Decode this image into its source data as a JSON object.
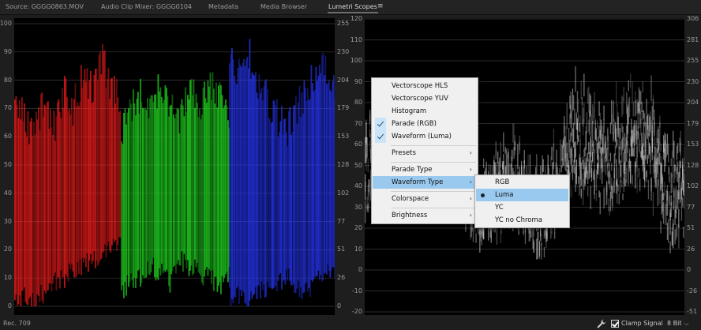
{
  "tabs": [
    {
      "label": "Source: GGGG0863.MOV",
      "active": false
    },
    {
      "label": "Audio Clip Mixer: GGGG0104",
      "active": false
    },
    {
      "label": "Metadata",
      "active": false
    },
    {
      "label": "Media Browser",
      "active": false
    },
    {
      "label": "Lumetri Scopes",
      "active": true
    }
  ],
  "parade_scope": {
    "left_axis": [
      "100",
      "90",
      "80",
      "70",
      "60",
      "50",
      "40",
      "30",
      "20",
      "10",
      "0"
    ],
    "right_axis": [
      "255",
      "230",
      "204",
      "179",
      "153",
      "128",
      "102",
      "77",
      "51",
      "26",
      "0"
    ],
    "channel_colors": [
      "#ff1e1e",
      "#22e022",
      "#2838ff"
    ]
  },
  "waveform_scope": {
    "left_axis": [
      "120",
      "110",
      "100",
      "90",
      "80",
      "70",
      "60",
      "50",
      "40",
      "30",
      "20",
      "10",
      "0",
      "-10",
      "-20"
    ],
    "right_axis": [
      "306",
      "281",
      "255",
      "230",
      "204",
      "179",
      "153",
      "128",
      "102",
      "77",
      "51",
      "26",
      "0",
      "-26",
      "-51"
    ]
  },
  "context_menu": {
    "items": [
      {
        "label": "Vectorscope HLS",
        "checked": false
      },
      {
        "label": "Vectorscope YUV",
        "checked": false
      },
      {
        "label": "Histogram",
        "checked": false
      },
      {
        "label": "Parade (RGB)",
        "checked": true
      },
      {
        "label": "Waveform (Luma)",
        "checked": true
      },
      {
        "label": "Presets",
        "submenu": true
      },
      {
        "label": "Parade Type",
        "submenu": true
      },
      {
        "label": "Waveform Type",
        "submenu": true,
        "highlighted": true
      },
      {
        "label": "Colorspace",
        "submenu": true
      },
      {
        "label": "Brightness",
        "submenu": true
      }
    ]
  },
  "waveform_type_submenu": {
    "items": [
      {
        "label": "RGB",
        "selected": false
      },
      {
        "label": "Luma",
        "selected": true
      },
      {
        "label": "YC",
        "selected": false
      },
      {
        "label": "YC no Chroma",
        "selected": false
      }
    ]
  },
  "statusbar": {
    "colorspace": "Rec. 709",
    "clamp_label": "Clamp Signal",
    "clamp_checked": true,
    "bit_depth": "8 Bit"
  },
  "colors": {
    "menu_highlight": "#99c9ef",
    "check_box": "#cce4f7"
  },
  "icons": [
    "hamburger-menu-icon",
    "wrench-icon",
    "chevron-down-icon",
    "chevron-right-icon",
    "checkmark-icon"
  ]
}
